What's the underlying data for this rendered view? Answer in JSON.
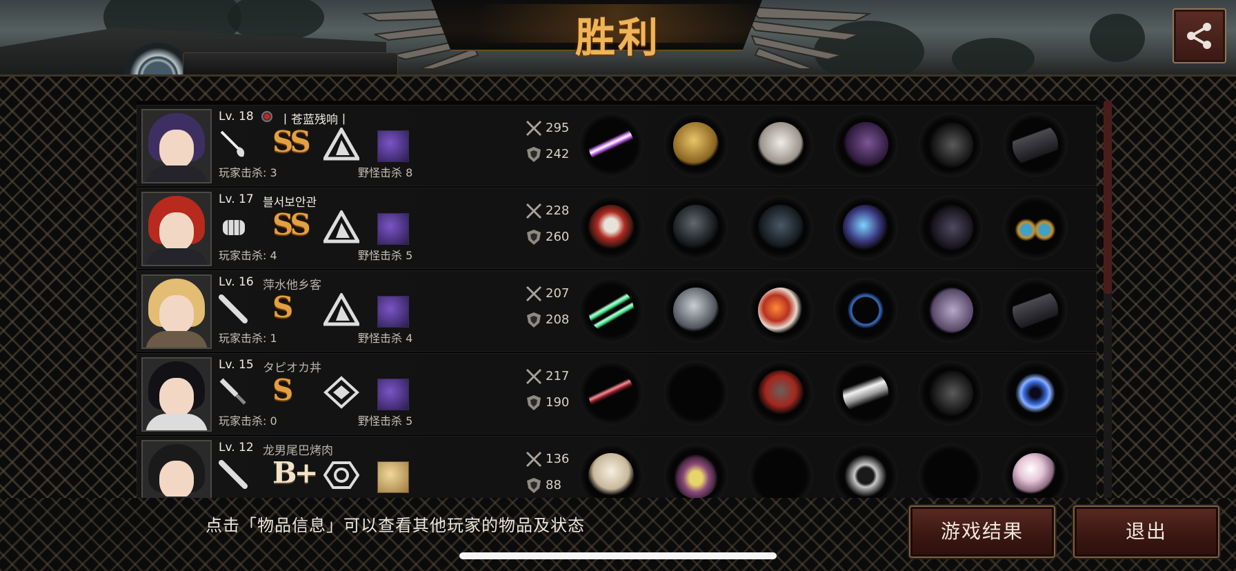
{
  "header": {
    "title": "胜利"
  },
  "players": [
    {
      "level": "Lv. 18",
      "name": "丨苍蓝残响丨",
      "grade": "SS",
      "player_kills_label": "玩家击杀: 3",
      "monster_kills_label": "野怪击杀 8",
      "attack": "295",
      "defense": "242",
      "weapon_icon": "rapier-icon",
      "items": [
        "purple-lightsaber",
        "golden-helmet",
        "white-armor",
        "purple-gauntlet",
        "black-boots",
        "black-flag"
      ]
    },
    {
      "level": "Lv. 17",
      "name": "블서보안관",
      "grade": "SS",
      "player_kills_label": "玩家击杀: 4",
      "monster_kills_label": "野怪击杀 5",
      "attack": "228",
      "defense": "260",
      "weapon_icon": "fist-icon",
      "items": [
        "red-gloves",
        "dark-helmet",
        "dark-armor",
        "lightning-gauntlet",
        "dark-boots",
        "gold-earrings"
      ]
    },
    {
      "level": "Lv. 16",
      "name": "萍水他乡客",
      "grade": "S",
      "player_kills_label": "玩家击杀: 1",
      "monster_kills_label": "野怪击杀 4",
      "attack": "207",
      "defense": "208",
      "weapon_icon": "bat-icon",
      "items": [
        "green-lightsabers",
        "steel-helmet",
        "red-armor",
        "blue-bracelet",
        "purple-boots",
        "black-flag"
      ]
    },
    {
      "level": "Lv. 15",
      "name": "タピオカ丼",
      "grade": "S",
      "player_kills_label": "玩家击杀: 0",
      "monster_kills_label": "野怪击杀 5",
      "attack": "217",
      "defense": "190",
      "weapon_icon": "knife-icon",
      "items": [
        "red-sword",
        "empty",
        "red-cape-armor",
        "silver-gauntlet",
        "black-boots",
        "galaxy-orb"
      ]
    },
    {
      "level": "Lv. 12",
      "name": "龙男尾巴烤肉",
      "grade": "B+",
      "player_kills_label": "",
      "monster_kills_label": "",
      "attack": "136",
      "defense": "88",
      "weapon_icon": "bat-icon",
      "items": [
        "white-cloth",
        "purple-hat",
        "empty",
        "smart-watch",
        "empty",
        "pearl"
      ]
    }
  ],
  "footer": {
    "hint": "点击「物品信息」可以查看其他玩家的物品及状态",
    "results_button": "游戏结果",
    "exit_button": "退出"
  },
  "colors": {
    "gold": "#f0b458",
    "button_red": "#5a2a22",
    "scroll_thumb": "#4a1d1b"
  }
}
